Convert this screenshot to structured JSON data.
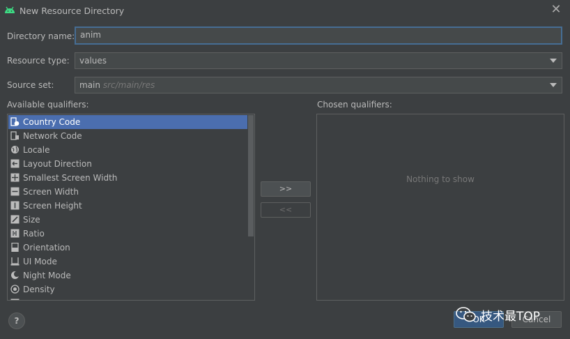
{
  "window": {
    "title": "New Resource Directory",
    "close_glyph": "✕"
  },
  "form": {
    "directory_label": "Directory name:",
    "directory_value": "anim",
    "resource_type_label": "Resource type:",
    "resource_type_value": "values",
    "source_set_label": "Source set:",
    "source_set_value": "main",
    "source_set_path": "src/main/res"
  },
  "available": {
    "label": "Available qualifiers:",
    "items": [
      {
        "label": "Country Code",
        "icon": "country-code-icon",
        "selected": true
      },
      {
        "label": "Network Code",
        "icon": "network-code-icon",
        "selected": false
      },
      {
        "label": "Locale",
        "icon": "globe-icon",
        "selected": false
      },
      {
        "label": "Layout Direction",
        "icon": "layout-direction-icon",
        "selected": false
      },
      {
        "label": "Smallest Screen Width",
        "icon": "smallest-width-icon",
        "selected": false
      },
      {
        "label": "Screen Width",
        "icon": "screen-width-icon",
        "selected": false
      },
      {
        "label": "Screen Height",
        "icon": "screen-height-icon",
        "selected": false
      },
      {
        "label": "Size",
        "icon": "size-icon",
        "selected": false
      },
      {
        "label": "Ratio",
        "icon": "ratio-icon",
        "selected": false
      },
      {
        "label": "Orientation",
        "icon": "orientation-icon",
        "selected": false
      },
      {
        "label": "UI Mode",
        "icon": "ui-mode-icon",
        "selected": false
      },
      {
        "label": "Night Mode",
        "icon": "night-mode-icon",
        "selected": false
      },
      {
        "label": "Density",
        "icon": "density-icon",
        "selected": false
      }
    ]
  },
  "transfer": {
    "add_label": ">>",
    "remove_label": "<<"
  },
  "chosen": {
    "label": "Chosen qualifiers:",
    "empty_text": "Nothing to show"
  },
  "footer": {
    "help_label": "?",
    "ok_label": "OK",
    "cancel_label": "Cancel"
  },
  "watermark": {
    "text": "技术最TOP"
  },
  "colors": {
    "selection": "#4b6eaf",
    "focus_border": "#466d94",
    "background": "#3c3f41",
    "android_green": "#3ddc84"
  }
}
